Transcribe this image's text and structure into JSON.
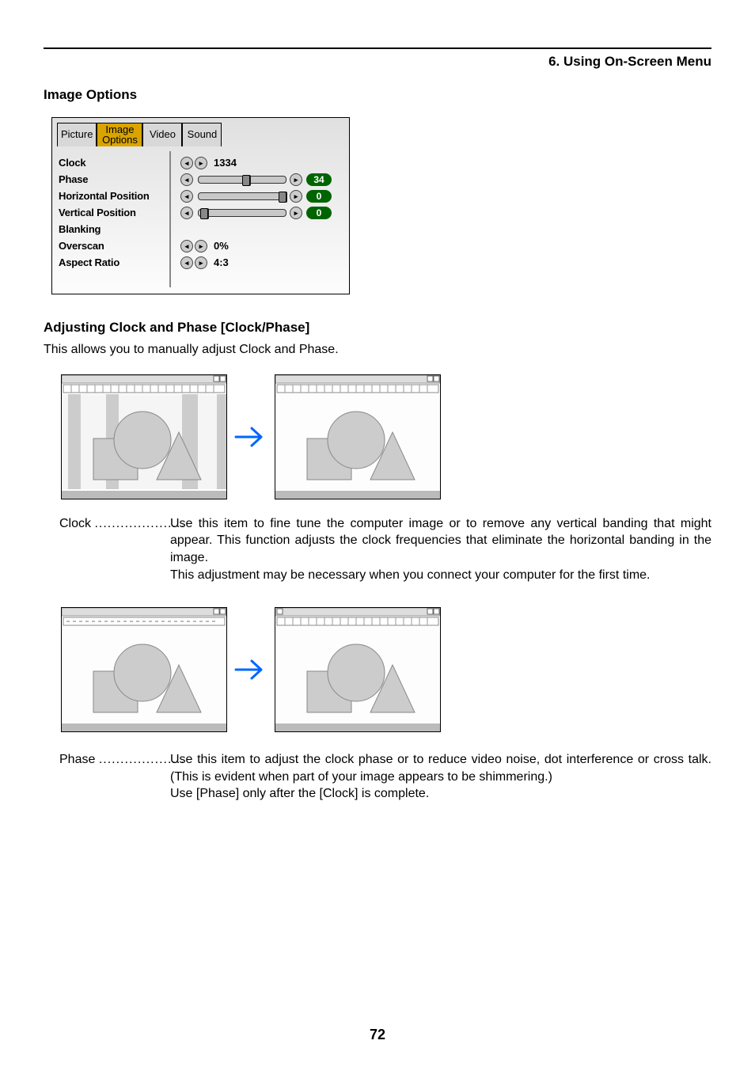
{
  "header": {
    "chapter": "6. Using On-Screen Menu"
  },
  "section_title": "Image Options",
  "osd": {
    "tabs": {
      "picture": "Picture",
      "image_options_line1": "Image",
      "image_options_line2": "Options",
      "video": "Video",
      "sound": "Sound"
    },
    "rows": {
      "clock": {
        "label": "Clock",
        "value": "1334"
      },
      "phase": {
        "label": "Phase",
        "value": "34"
      },
      "hpos": {
        "label": "Horizontal Position",
        "value": "0"
      },
      "vpos": {
        "label": "Vertical Position",
        "value": "0"
      },
      "blanking": {
        "label": "Blanking"
      },
      "overscan": {
        "label": "Overscan",
        "value": "0%"
      },
      "aspect": {
        "label": "Aspect Ratio",
        "value": "4:3"
      }
    }
  },
  "subheading": "Adjusting Clock and Phase [Clock/Phase]",
  "intro_text": "This allows you to manually adjust Clock and Phase.",
  "clock_desc": {
    "label": "Clock",
    "dots": ".....................",
    "p1": "Use this item to fine tune the computer image or to remove any vertical banding that might appear. This function adjusts the clock frequencies that eliminate the horizontal banding in the image.",
    "p2": "This adjustment may be necessary when you connect your computer for the first time."
  },
  "phase_desc": {
    "label": "Phase",
    "dots": "....................",
    "p1": "Use this item to adjust the clock phase or to reduce video noise, dot interference or cross talk. (This is evident when part of your image appears to be shimmering.)",
    "p2": "Use [Phase] only after the [Clock] is complete."
  },
  "page_number": "72"
}
